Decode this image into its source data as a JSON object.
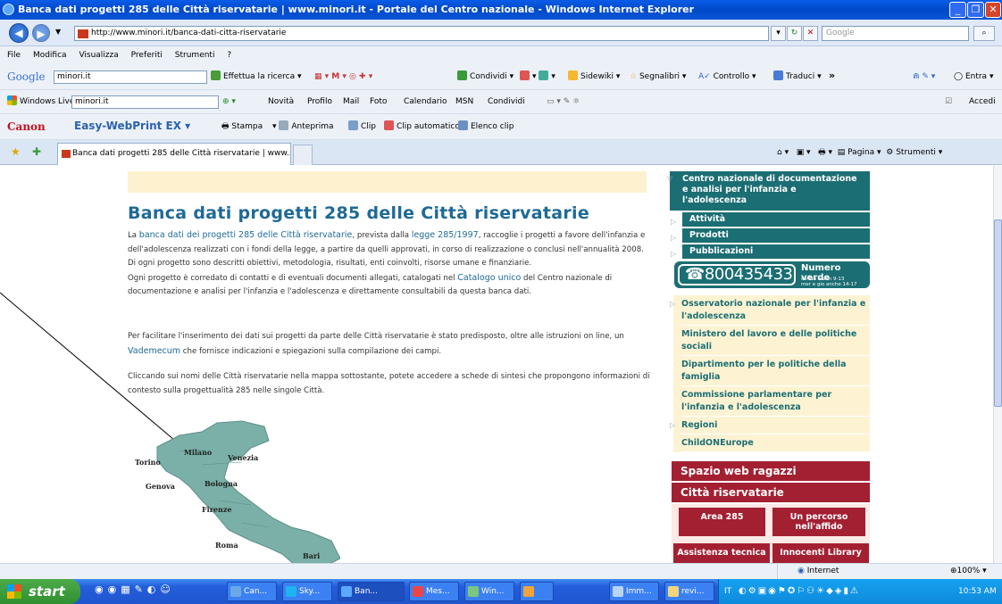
{
  "window": {
    "title": "Banca dati progetti 285 delle Città riservatarie | www.minori.it - Portale del Centro nazionale - Windows Internet Explorer"
  },
  "address": {
    "url": "http://www.minori.it/banca-dati-citta-riservatarie",
    "search_placeholder": "Google"
  },
  "menu": [
    "File",
    "Modifica",
    "Visualizza",
    "Preferiti",
    "Strumenti",
    "?"
  ],
  "google_toolbar": {
    "brand": "Google",
    "query": "minori.it",
    "search_btn": "Effettua la ricerca",
    "condividi": "Condividi",
    "sidewiki": "Sidewiki",
    "segnalibri": "Segnalibri",
    "controllo": "Controllo",
    "traduci": "Traduci",
    "more": "»",
    "entra": "Entra"
  },
  "live_toolbar": {
    "brand": "Windows Live",
    "query": "minori.it",
    "items": [
      "Novità",
      "Profilo",
      "Mail",
      "Foto",
      "Calendario",
      "MSN",
      "Condividi"
    ],
    "accedi": "Accedi"
  },
  "canon_toolbar": {
    "brand": "Canon",
    "product": "Easy-WebPrint EX",
    "stampa": "Stampa",
    "anteprima": "Anteprima",
    "clip": "Clip",
    "clip_auto": "Clip automatico",
    "elenco": "Elenco clip"
  },
  "tabs": {
    "active": "Banca dati progetti 285 delle Città riservatarie | www....",
    "pagina": "Pagina",
    "strumenti": "Strumenti"
  },
  "page": {
    "heading": "Banca dati progetti 285 delle Città riservatarie",
    "p1_a": "La ",
    "p1_link1": "banca dati dei progetti 285 delle Città riservatarie",
    "p1_b": ", prevista dalla ",
    "p1_link2": "legge 285/1997",
    "p1_c": ", raccoglie i progetti a favore dell'infanzia e dell'adolescenza realizzati con i fondi della legge, a partire da quelli approvati, in corso di realizzazione o conclusi nell'annualità 2008.",
    "p2": "Di ogni progetto sono descritti obiettivi, metodologia, risultati, enti coinvolti, risorse umane e finanziarie.",
    "p3_a": "Ogni progetto è corredato di contatti e di eventuali documenti allegati, catalogati nel ",
    "p3_link": "Catalogo unico",
    "p3_b": " del Centro nazionale di documentazione e analisi per l'infanzia e l'adolescenza e direttamente consultabili da questa banca dati.",
    "p4_a": "Per facilitare l'inserimento dei dati sui progetti da parte delle Città riservatarie è stato predisposto, oltre alle istruzioni on line, un ",
    "p4_link": "Vademecum",
    "p4_b": " che fornisce indicazioni e spiegazioni sulla compilazione dei campi.",
    "p5": "Cliccando sui nomi delle Città riservatarie nella mappa sottostante, potete accedere a schede di sintesi che propongono informazioni di contesto sulla progettualità 285 nelle singole Città.",
    "cities": [
      "Torino",
      "Milano",
      "Venezia",
      "Genova",
      "Bologna",
      "Firenze",
      "Roma",
      "Bari"
    ]
  },
  "sidebar": {
    "header": "Centro nazionale di documentazione e analisi per l'infanzia e l'adolescenza",
    "sub": [
      "Attività",
      "Prodotti",
      "Pubblicazioni"
    ],
    "phone": "800435433",
    "numero_verde": "Numero verde",
    "hours1": "da lun a ven 9-13",
    "hours2": "mer e gio anche 14-17",
    "links": [
      "Osservatorio nazionale per l'infanzia e l'adolescenza",
      "Ministero del lavoro e delle politiche sociali",
      "Dipartimento per le politiche della famiglia",
      "Commissione parlamentare per l'infanzia e l'adolescenza",
      "Regioni",
      "ChildONEurope"
    ],
    "spazio": "Spazio web ragazzi",
    "citta": "Città riservatarie",
    "area285": "Area 285",
    "percorso": "Un percorso nell'affido",
    "assistenza": "Assistenza tecnica",
    "library": "Innocenti Library"
  },
  "status": {
    "zone": "Internet",
    "zoom": "100%"
  },
  "taskbar": {
    "start": "start",
    "items": [
      "Can...",
      "Sky...",
      "Ban...",
      "Mes...",
      "Win...",
      "",
      "Imm...",
      "revi..."
    ],
    "lang": "IT",
    "clock": "10:53 AM"
  }
}
